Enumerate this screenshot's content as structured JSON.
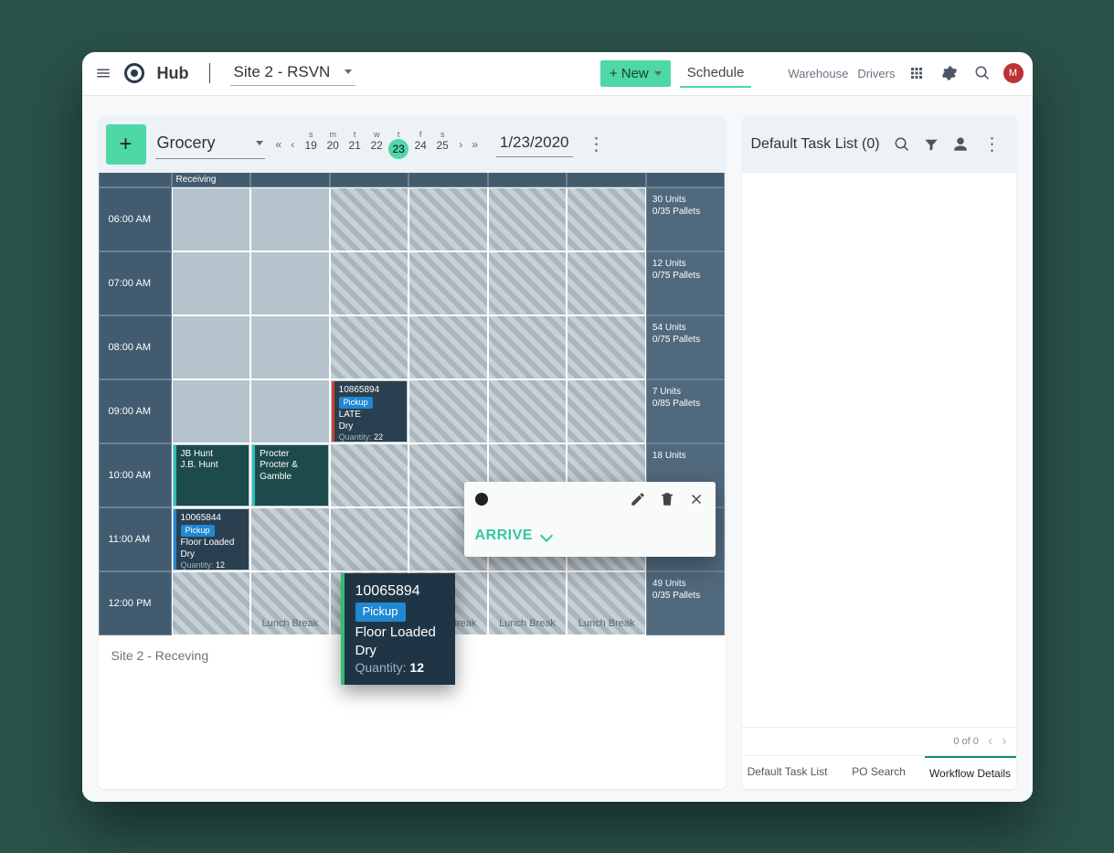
{
  "header": {
    "brand": "Hub",
    "site_label": "Site 2 - RSVN",
    "new_button": "+ New",
    "schedule_label": "Schedule",
    "nav": {
      "warehouse": "Warehouse",
      "drivers": "Drivers"
    },
    "avatar_initial": "M"
  },
  "schedule_header": {
    "category": "Grocery",
    "days": [
      {
        "dow": "s",
        "num": "19"
      },
      {
        "dow": "m",
        "num": "20"
      },
      {
        "dow": "t",
        "num": "21"
      },
      {
        "dow": "w",
        "num": "22"
      },
      {
        "dow": "t",
        "num": "23",
        "selected": true
      },
      {
        "dow": "f",
        "num": "24"
      },
      {
        "dow": "s",
        "num": "25"
      }
    ],
    "date": "1/23/2020",
    "column_header": "Receiving"
  },
  "times": [
    "06:00 AM",
    "07:00 AM",
    "08:00 AM",
    "09:00 AM",
    "10:00 AM",
    "11:00 AM",
    "12:00 PM"
  ],
  "lunch_label": "Lunch Break",
  "info_cells": [
    {
      "units": "30 Units",
      "pallets": "0/35 Pallets"
    },
    {
      "units": "12 Units",
      "pallets": "0/75 Pallets"
    },
    {
      "units": "54 Units",
      "pallets": "0/75 Pallets"
    },
    {
      "units": "7 Units",
      "pallets": "0/85 Pallets"
    },
    {
      "units": "18 Units",
      "pallets": ""
    },
    {
      "units": "",
      "pallets": ""
    },
    {
      "units": "49 Units",
      "pallets": "0/35 Pallets"
    }
  ],
  "cards": {
    "c1": {
      "id": "10865894",
      "badge": "Pickup",
      "line1": "LATE",
      "line2": "Dry",
      "qty_label": "Quantity:",
      "qty": "22"
    },
    "c2": {
      "line1": "JB Hunt",
      "line2": "J.B. Hunt"
    },
    "c3": {
      "line1": "Procter",
      "line2": "Procter & Gamble"
    },
    "c4": {
      "id": "10065844",
      "badge": "Pickup",
      "line1": "Floor Loaded",
      "line2": "Dry",
      "qty_label": "Quantity:",
      "qty": "12"
    }
  },
  "zoom": {
    "id": "10065894",
    "badge": "Pickup",
    "line1": "Floor Loaded",
    "line2": "Dry",
    "qty_label": "Quantity:",
    "qty": "12"
  },
  "popover": {
    "arrive": "ARRIVE"
  },
  "left_footer": "Site 2 - Receving",
  "tasklist": {
    "title": "Default Task List (0)",
    "pager": "0 of 0",
    "tabs": [
      "Default Task List",
      "PO Search",
      "Workflow Details"
    ]
  }
}
